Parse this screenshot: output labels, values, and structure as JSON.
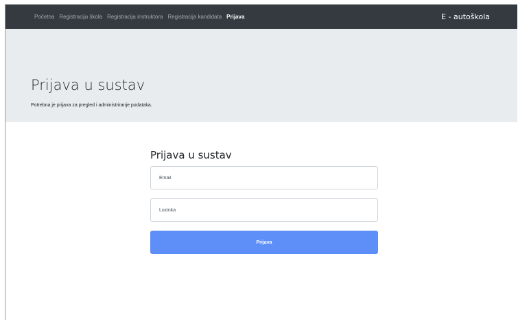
{
  "navbar": {
    "links": [
      {
        "label": "Početna"
      },
      {
        "label": "Registracija škola"
      },
      {
        "label": "Registracija instruktora"
      },
      {
        "label": "Registracija kandidata"
      },
      {
        "label": "Prijava",
        "active": true
      }
    ],
    "brand": "E - autoškola",
    "bg_color": "#343a40"
  },
  "jumbotron": {
    "title": "Prijava u sustav",
    "lead": "Potrebna je prijava za pregled i administriranje podataka.",
    "bg_color": "#e9ecef"
  },
  "login_form": {
    "title": "Prijava u sustav",
    "email_placeholder": "Email",
    "password_placeholder": "Lozinka",
    "submit_label": "Prijava",
    "button_color": "#5e8ef7"
  }
}
